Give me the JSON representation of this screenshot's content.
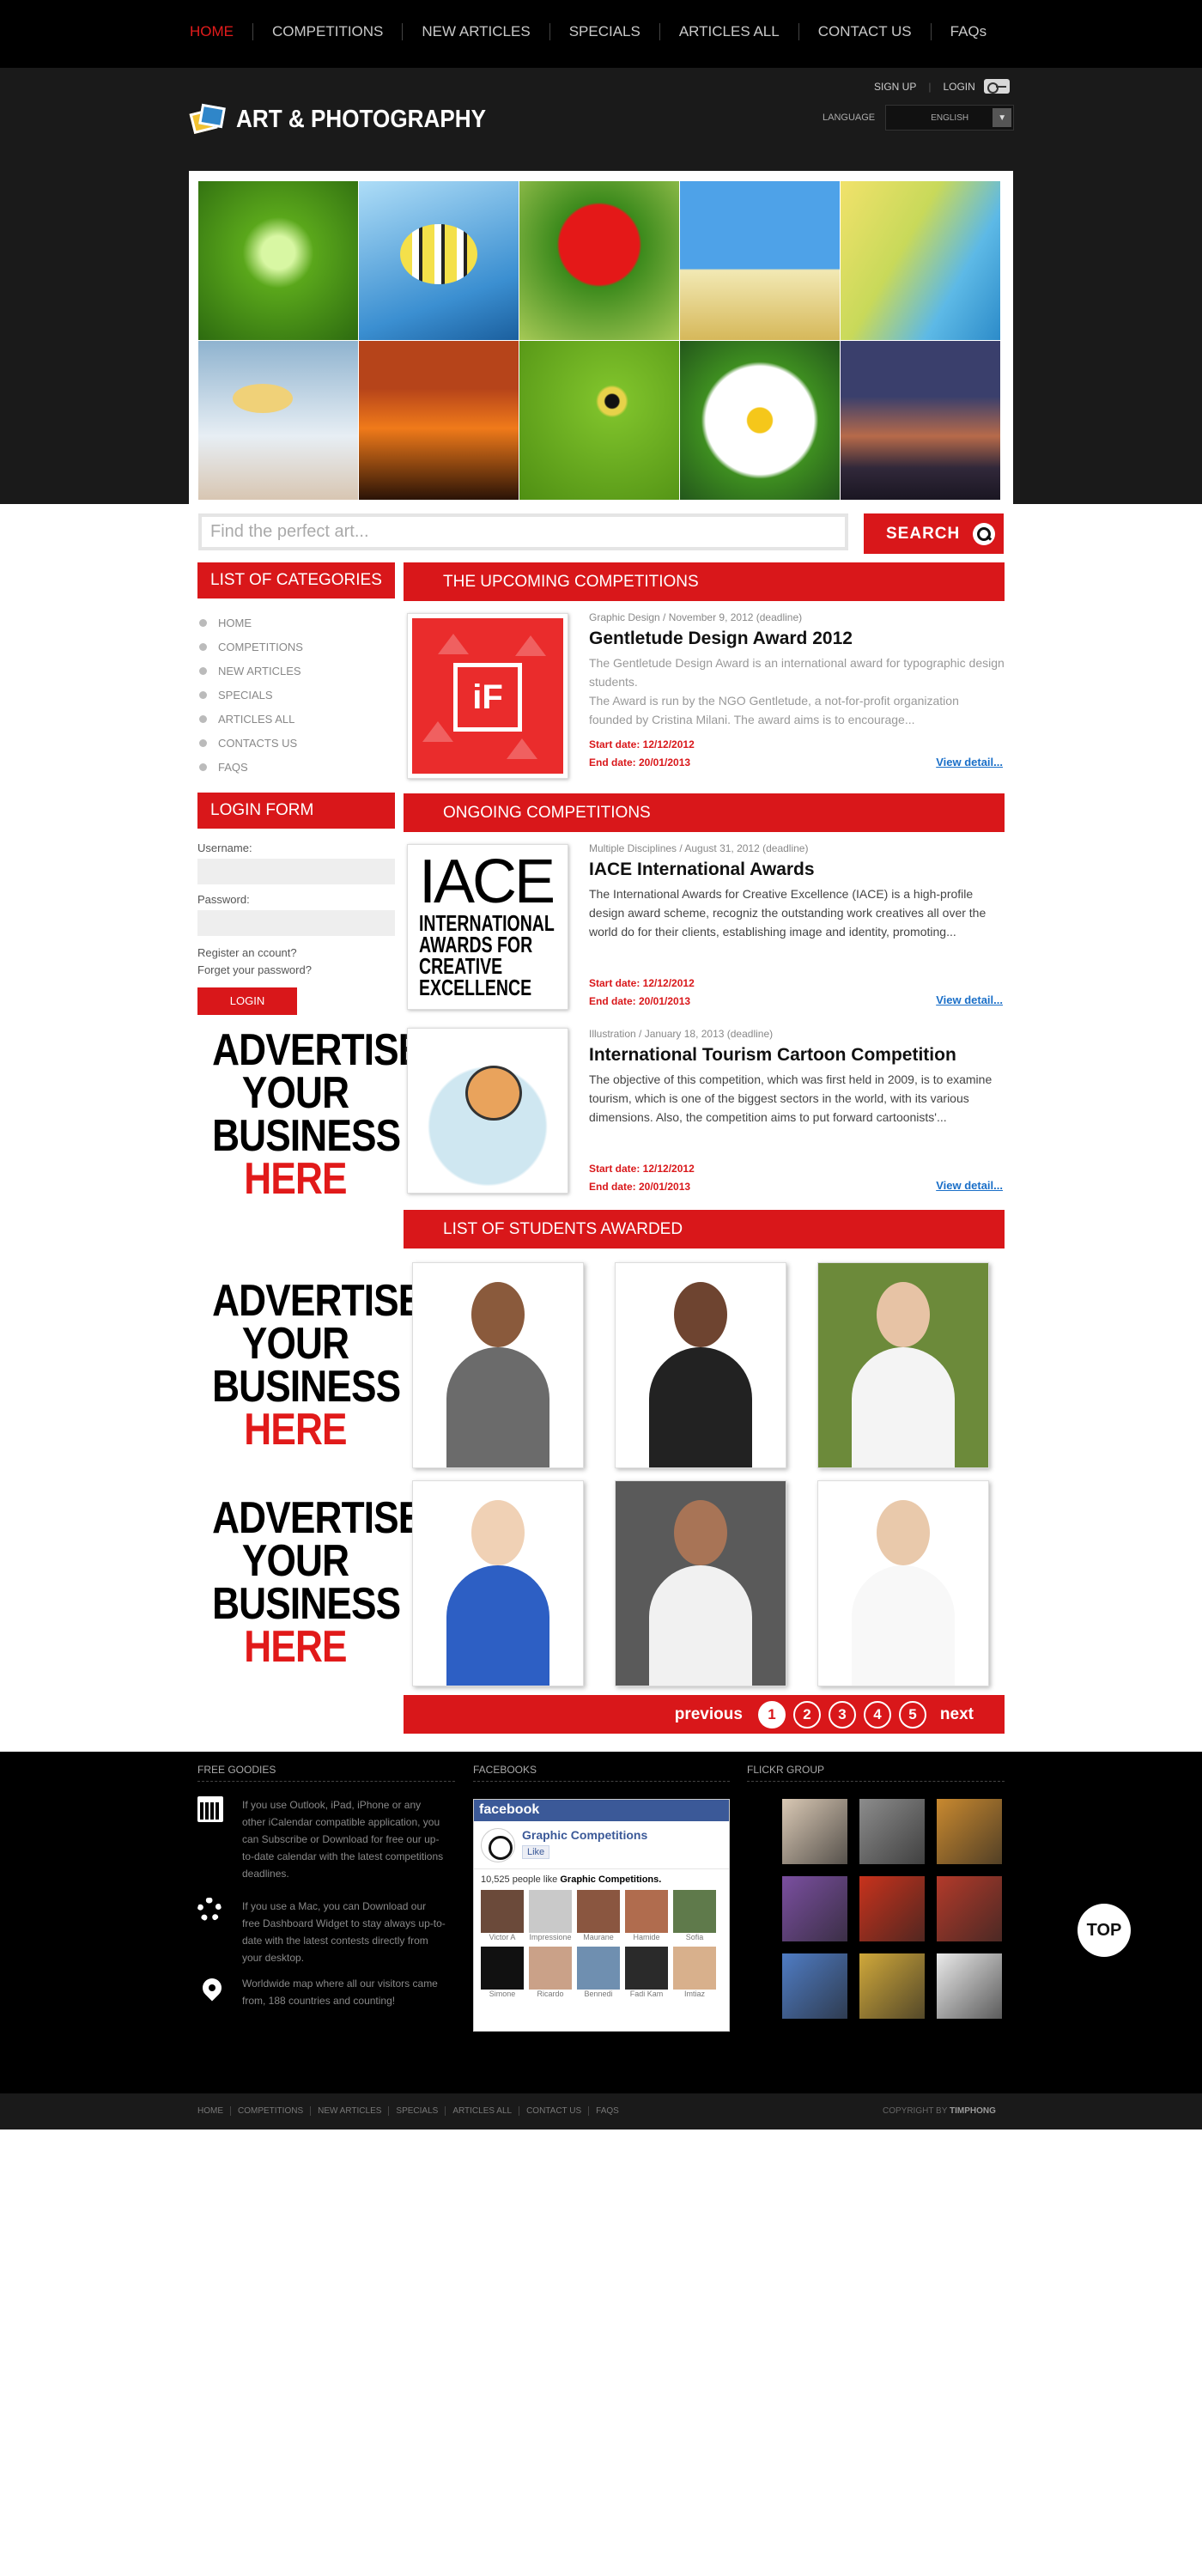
{
  "nav": {
    "items": [
      "HOME",
      "COMPETITIONS",
      "NEW ARTICLES",
      "SPECIALS",
      "ARTICLES ALL",
      "CONTACT US",
      "FAQs"
    ]
  },
  "header": {
    "logo_text": "ART & PHOTOGRAPHY",
    "sign_up": "SIGN UP",
    "login": "LOGIN",
    "language_label": "LANGUAGE",
    "language_value": "ENGLISH"
  },
  "search": {
    "placeholder": "Find the perfect art...",
    "button": "SEARCH"
  },
  "sidebar": {
    "categories_title": "LIST OF CATEGORIES",
    "categories": [
      "HOME",
      "COMPETITIONS",
      "NEW ARTICLES",
      "SPECIALS",
      "ARTICLES ALL",
      "CONTACTS US",
      "FAQS"
    ],
    "login_title": "LOGIN FORM",
    "username_label": "Username:",
    "password_label": "Password:",
    "register_link": "Register an ccount?",
    "forget_link": "Forget your password?",
    "login_button": "LOGIN",
    "ad": {
      "line1": "ADVERTISE",
      "line2": "YOUR",
      "line3": "BUSINESS",
      "line4": "HERE"
    }
  },
  "upcoming": {
    "title": "THE UPCOMING COMPETITIONS",
    "items": [
      {
        "meta": "Graphic Design / November 9, 2012 (deadline)",
        "title": "Gentletude Design Award 2012",
        "desc1": "The Gentletude Design Award is an international award for typographic design students.",
        "desc2": "The Award is run by the NGO Gentletude, a not-for-profit organization founded by Cristina Milani. The award aims is to encourage...",
        "start": "Start date: 12/12/2012",
        "end": "End date: 20/01/2013",
        "view": "View detail..."
      }
    ]
  },
  "ongoing": {
    "title": "ONGOING COMPETITIONS",
    "items": [
      {
        "meta": "Multiple Disciplines / August 31, 2012 (deadline)",
        "title": "IACE International Awards",
        "desc": "The International Awards for Creative Excellence (IACE) is a high-profile design award scheme, recogniz the outstanding work creatives all over the world do for their clients, establishing image and identity, promoting...",
        "thumb_big": "IACE",
        "thumb_small": [
          "INTERNATIONAL",
          "AWARDS FOR",
          "CREATIVE",
          "EXCELLENCE"
        ],
        "start": "Start date: 12/12/2012",
        "end": "End date: 20/01/2013",
        "view": "View detail..."
      },
      {
        "meta": "Illustration / January 18, 2013 (deadline)",
        "title": "International Tourism Cartoon Competition",
        "desc": "The objective of this competition, which was first held in 2009, is to examine tourism, which is one of the biggest sectors in the world, with its various dimensions. Also, the competition aims to put forward cartoonists'...",
        "start": "Start date: 12/12/2012",
        "end": "End date: 20/01/2013",
        "view": "View detail..."
      }
    ]
  },
  "students": {
    "title": "LIST OF STUDENTS AWARDED",
    "photos": [
      {
        "skin": "#8a5a3c",
        "shirt": "#6b6b6b",
        "bg": "#ffffff"
      },
      {
        "skin": "#6e4430",
        "shirt": "#222222",
        "bg": "#ffffff"
      },
      {
        "skin": "#e7c3a5",
        "shirt": "#f4f4f4",
        "bg": "#6c8a3a"
      },
      {
        "skin": "#f0d1b5",
        "shirt": "#2d5fc4",
        "bg": "#ffffff"
      },
      {
        "skin": "#a87456",
        "shirt": "#f1f1f1",
        "bg": "#5a5a5a"
      },
      {
        "skin": "#e9c9ab",
        "shirt": "#f8f8f8",
        "bg": "#ffffff"
      }
    ]
  },
  "pager": {
    "previous": "previous",
    "pages": [
      "1",
      "2",
      "3",
      "4",
      "5"
    ],
    "next": "next"
  },
  "footer": {
    "goodies_title": "FREE GOODIES",
    "goodies": [
      "If you use Outlook, iPad, iPhone or any other iCalendar compatible application, you can Subscribe or Download for free our up-to-date calendar with the latest competitions deadlines.",
      "If you use a Mac, you can Download our free Dashboard Widget to stay always up-to-date with the latest contests directly from your desktop.",
      "Worldwide map where all our visitors came from, 188 countries and counting!"
    ],
    "facebook_title": "FACEBOOKS",
    "fb": {
      "brand": "facebook",
      "page_name": "Graphic Competitions",
      "like": "Like",
      "count_prefix": "10,525 people like ",
      "count_page": "Graphic Competitions.",
      "faces": [
        {
          "name": "Victor A",
          "color": "#6b4a3a"
        },
        {
          "name": "Impressione",
          "color": "#c9c9c9"
        },
        {
          "name": "Maurane",
          "color": "#8a5640"
        },
        {
          "name": "Hamide",
          "color": "#b06c4e"
        },
        {
          "name": "Sofia",
          "color": "#5f7a4b"
        },
        {
          "name": "Simone",
          "color": "#111111"
        },
        {
          "name": "Ricardo",
          "color": "#caa188"
        },
        {
          "name": "Bennedi",
          "color": "#6f8fb0"
        },
        {
          "name": "Fadi Kam",
          "color": "#2a2a2a"
        },
        {
          "name": "Imtiaz",
          "color": "#d8b08c"
        }
      ]
    },
    "flickr_title": "FLICKR GROUP",
    "flickr": [
      "#d9c8b4",
      "#8c8c8c",
      "#c9892f",
      "#7a4fa0",
      "#c8321c",
      "#b33a2a",
      "#4f7cc4",
      "#d0a83a",
      "#eaeaea"
    ],
    "top": "TOP"
  },
  "bottom": {
    "links": [
      "HOME",
      "COMPETITIONS",
      "NEW ARTICLES",
      "SPECIALS",
      "ARTICLES ALL",
      "CONTACT US",
      "FAQS"
    ],
    "copyright_prefix": "COPYRIGHT BY ",
    "copyright_name": "TIMPHONG"
  }
}
